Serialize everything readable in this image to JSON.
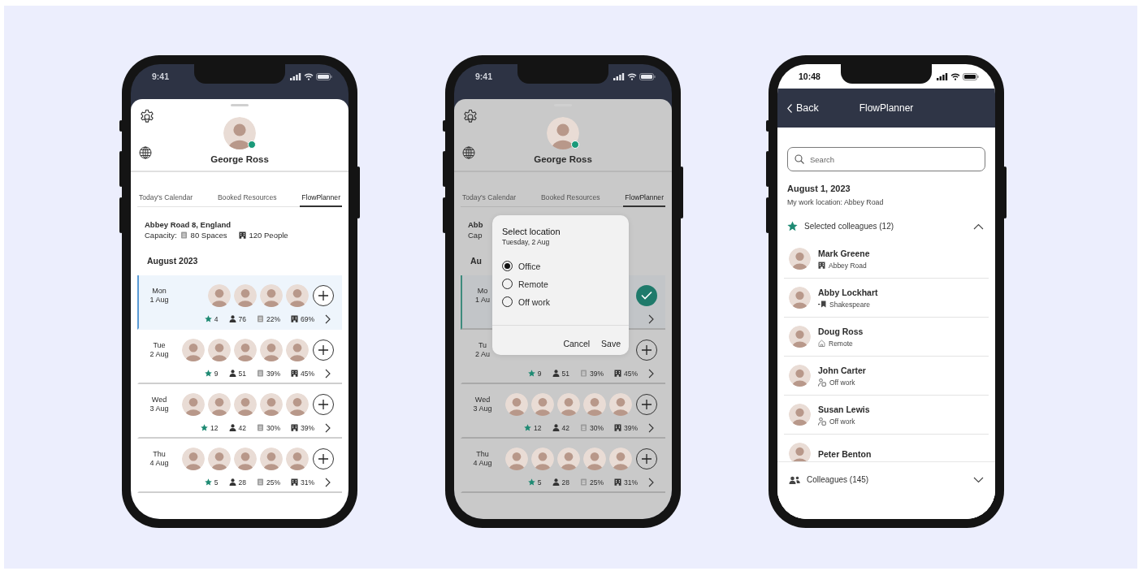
{
  "phones": [
    {
      "kind": "planner",
      "dimmed": false,
      "status_time": "9:41",
      "profile": {
        "name": "George Ross",
        "online": true
      },
      "tabs": [
        {
          "label": "Today's Calendar",
          "selected": false
        },
        {
          "label": "Booked Resources",
          "selected": false
        },
        {
          "label": "FlowPlanner",
          "selected": true
        }
      ],
      "location": {
        "name": "Abbey Road 8, England",
        "capacity_label": "Capacity:",
        "spaces": "80 Spaces",
        "people": "120 People"
      },
      "month": "August 2023",
      "days": [
        {
          "weekday": "Mon",
          "date": "1 Aug",
          "selected": true,
          "attendees": [
            {
              "kind": "photo"
            },
            {
              "kind": "photo"
            },
            {
              "kind": "photo"
            },
            {
              "kind": "photo"
            }
          ],
          "added": false,
          "stats": {
            "favorites": "4",
            "people": "76",
            "desks": "22%",
            "rooms": "69%"
          }
        },
        {
          "weekday": "Tue",
          "date": "2 Aug",
          "selected": false,
          "attendees": [
            {
              "kind": "photo"
            },
            {
              "kind": "photo"
            },
            {
              "kind": "photo"
            },
            {
              "kind": "photo"
            },
            {
              "kind": "photo"
            }
          ],
          "added": false,
          "stats": {
            "favorites": "9",
            "people": "51",
            "desks": "39%",
            "rooms": "45%"
          }
        },
        {
          "weekday": "Wed",
          "date": "3 Aug",
          "selected": false,
          "attendees": [
            {
              "kind": "photo"
            },
            {
              "kind": "photo"
            },
            {
              "kind": "photo"
            },
            {
              "kind": "photo"
            },
            {
              "kind": "photo"
            }
          ],
          "added": false,
          "stats": {
            "favorites": "12",
            "people": "42",
            "desks": "30%",
            "rooms": "39%"
          }
        },
        {
          "weekday": "Thu",
          "date": "4 Aug",
          "selected": false,
          "attendees": [
            {
              "kind": "photo"
            },
            {
              "kind": "photo"
            },
            {
              "kind": "photo"
            },
            {
              "kind": "photo"
            },
            {
              "kind": "photo"
            }
          ],
          "added": false,
          "stats": {
            "favorites": "5",
            "people": "28",
            "desks": "25%",
            "rooms": "31%"
          }
        }
      ]
    },
    {
      "kind": "planner",
      "dimmed": true,
      "status_time": "9:41",
      "profile": {
        "name": "George Ross",
        "online": true
      },
      "tabs": [
        {
          "label": "Today's Calendar",
          "selected": false
        },
        {
          "label": "Booked Resources",
          "selected": false
        },
        {
          "label": "FlowPlanner",
          "selected": true
        }
      ],
      "location": {
        "name": "Abb",
        "capacity_label": "Cap"
      },
      "month": "Au",
      "days": [
        {
          "weekday": "Mo",
          "date": "1 Au",
          "selected": true,
          "added": true
        },
        {
          "weekday": "Tu",
          "date": "2 Au",
          "selected": false,
          "added": false,
          "stats": {
            "favorites": "9",
            "people": "51",
            "desks": "39%",
            "rooms": "45%"
          }
        },
        {
          "weekday": "Wed",
          "date": "3 Aug",
          "selected": false,
          "attendees": [
            {
              "kind": "photo"
            },
            {
              "kind": "photo"
            },
            {
              "kind": "photo"
            },
            {
              "kind": "photo"
            },
            {
              "kind": "photo"
            }
          ],
          "added": false,
          "stats": {
            "favorites": "12",
            "people": "42",
            "desks": "30%",
            "rooms": "39%"
          }
        },
        {
          "weekday": "Thu",
          "date": "4 Aug",
          "selected": false,
          "attendees": [
            {
              "kind": "photo"
            },
            {
              "kind": "photo"
            },
            {
              "kind": "photo"
            },
            {
              "kind": "photo"
            },
            {
              "kind": "photo"
            }
          ],
          "added": false,
          "stats": {
            "favorites": "5",
            "people": "28",
            "desks": "25%",
            "rooms": "31%"
          }
        }
      ],
      "dialog": {
        "title": "Select location",
        "subtitle": "Tuesday, 2 Aug",
        "options": [
          {
            "label": "Office",
            "selected": true
          },
          {
            "label": "Remote",
            "selected": false
          },
          {
            "label": "Off work",
            "selected": false
          }
        ],
        "buttons": [
          "Cancel",
          "Save"
        ]
      }
    },
    {
      "kind": "colleagues",
      "status_time": "10:48",
      "nav": {
        "back": "Back",
        "title": "FlowPlanner"
      },
      "search": {
        "placeholder": "Search"
      },
      "date": "August 1, 2023",
      "work_location": "My work location: Abbey Road",
      "selected_section": {
        "label": "Selected colleagues (12)",
        "expanded": true
      },
      "colleagues": [
        {
          "name": "Mark Greene",
          "location": "Abbey Road",
          "kind": "office"
        },
        {
          "name": "Abby Lockhart",
          "location": "Shakespeare",
          "kind": "desk"
        },
        {
          "name": "Doug Ross",
          "location": "Remote",
          "kind": "remote"
        },
        {
          "name": "John Carter",
          "location": "Off work",
          "kind": "off"
        },
        {
          "name": "Susan Lewis",
          "location": "Off work",
          "kind": "off"
        },
        {
          "name": "Peter Benton"
        }
      ],
      "all_section": {
        "label": "Colleagues (145)",
        "expanded": false
      }
    }
  ]
}
